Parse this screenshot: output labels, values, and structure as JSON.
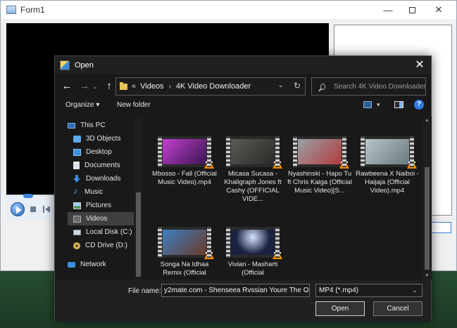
{
  "form1": {
    "title": "Form1",
    "minimize_glyph": "—",
    "close_glyph": "✕"
  },
  "dialog": {
    "title": "Open",
    "close_glyph": "✕"
  },
  "nav": {
    "back_glyph": "←",
    "forward_glyph": "→",
    "history_glyph": "⌄",
    "up_glyph": "↑"
  },
  "address": {
    "overflow": "«",
    "separator": "›",
    "segments": [
      "Videos",
      "4K Video Downloader"
    ],
    "dropdown_glyph": "⌄",
    "refresh_glyph": "↻"
  },
  "search": {
    "placeholder": "Search 4K Video Downloader"
  },
  "toolbar": {
    "organize": "Organize ▾",
    "new_folder": "New folder",
    "view_dropdown_glyph": "▾",
    "help": "?"
  },
  "nav_pane": {
    "items": [
      {
        "label": "This PC",
        "icon": "computer-icon",
        "selected": false
      },
      {
        "label": "3D Objects",
        "icon": "3d-objects-icon",
        "selected": false
      },
      {
        "label": "Desktop",
        "icon": "desktop-icon",
        "selected": false
      },
      {
        "label": "Documents",
        "icon": "documents-icon",
        "selected": false
      },
      {
        "label": "Downloads",
        "icon": "downloads-icon",
        "selected": false
      },
      {
        "label": "Music",
        "icon": "music-icon",
        "selected": false
      },
      {
        "label": "Pictures",
        "icon": "pictures-icon",
        "selected": false
      },
      {
        "label": "Videos",
        "icon": "videos-icon",
        "selected": true
      },
      {
        "label": "Local Disk (C:)",
        "icon": "disk-icon",
        "selected": false
      },
      {
        "label": "CD Drive (D:)",
        "icon": "cd-drive-icon",
        "selected": false
      },
      {
        "label": "Network",
        "icon": "network-icon",
        "selected": false
      }
    ]
  },
  "files": [
    {
      "name": "Mbosso - Fall (Official Music Video).mp4",
      "thumb_colors": [
        "#c43fd1",
        "#3a1650"
      ]
    },
    {
      "name": "Micasa Sucasa - Khaligraph Jones ft  Cashy (OFFICIAL VIDE...",
      "thumb_colors": [
        "#5c5a55",
        "#2a2a28"
      ]
    },
    {
      "name": "Nyashinski - Hapo Tu ft Chris Kaiga (Official Music Video)[S...",
      "thumb_colors": [
        "#9aa0a8",
        "#b23b3b"
      ]
    },
    {
      "name": "Rawbeena X Naiboi - Haijaja (Official Video).mp4",
      "thumb_colors": [
        "#b9c4c8",
        "#6a7a80"
      ]
    },
    {
      "name": "Songa Na Idhaa Remix (Official",
      "thumb_colors": [
        "#3d7fc0",
        "#6b3a2a"
      ]
    },
    {
      "name": "Vivian - Masharti (Official",
      "thumb_colors": [
        "#1a2240",
        "#d6e4ff"
      ]
    }
  ],
  "bottom": {
    "file_name_label": "File name:",
    "file_name_value": "y2mate.com - Shenseea Rvssian  Youre The O",
    "file_type_value": "MP4 (*.mp4)",
    "dropdown_glyph": "⌄",
    "open_label": "Open",
    "cancel_label": "Cancel"
  },
  "scroll": {
    "up_glyph": "▲",
    "down_glyph": "▼"
  }
}
